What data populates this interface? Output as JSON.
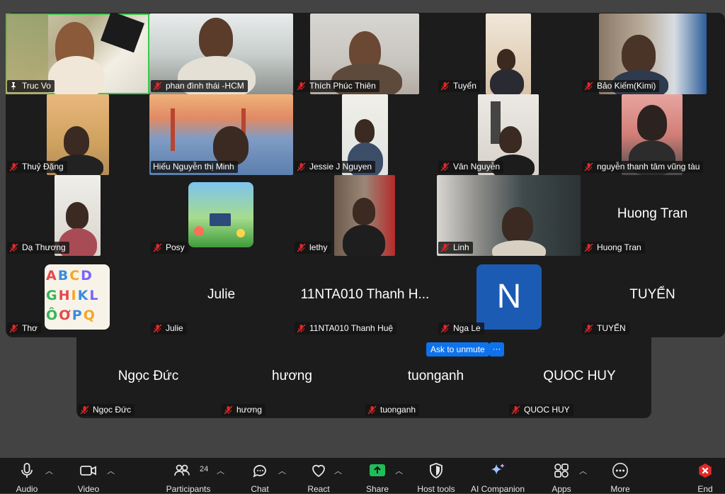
{
  "participants": [
    {
      "name": "Truc Vo",
      "tag_icon": "pin-icon"
    },
    {
      "name": "phan đình thái -HCM"
    },
    {
      "name": "Thích Phúc Thiên"
    },
    {
      "name": "Tuyển"
    },
    {
      "name": "Bảo Kiếm(Kimi)"
    },
    {
      "name": "Thuỷ Đặng"
    },
    {
      "name": "Hiếu Nguyễn thị Minh"
    },
    {
      "name": "Jessie J Nguyen"
    },
    {
      "name": "Vân Nguyễn"
    },
    {
      "name": "nguyễn thanh tâm  vũng tàu"
    },
    {
      "name": "Dạ Thương"
    },
    {
      "name": "Posy"
    },
    {
      "name": "lethy"
    },
    {
      "name": "Linh"
    },
    {
      "name": "Huong Tran",
      "display": "Huong Tran"
    },
    {
      "name": "Thơ"
    },
    {
      "name": "Julie",
      "display": "Julie"
    },
    {
      "name": "11NTA010 Thanh Huệ",
      "display": "11NTA010 Thanh H..."
    },
    {
      "name": "Nga Le",
      "avatar_letter": "N"
    },
    {
      "name": "TUYỂN",
      "display": "TUYỂN"
    },
    {
      "name": "Ngọc Đức",
      "display": "Ngọc Đức"
    },
    {
      "name": "hương",
      "display": "hương"
    },
    {
      "name": "tuonganh",
      "display": "tuonganh"
    },
    {
      "name": "QUOC HUY",
      "display": "QUOC HUY"
    }
  ],
  "hover_menu": {
    "ask_unmute": "Ask to unmute",
    "more": "···"
  },
  "toolbar": {
    "audio": "Audio",
    "video": "Video",
    "participants": "Participants",
    "participants_count": "24",
    "chat": "Chat",
    "react": "React",
    "share": "Share",
    "host_tools": "Host tools",
    "ai_companion": "AI Companion",
    "apps": "Apps",
    "more": "More",
    "end": "End"
  },
  "colors": {
    "active_speaker": "#38c94a",
    "accent": "#0e72ed",
    "muted": "#e02828",
    "share": "#1fbd58",
    "end": "#e02828"
  }
}
